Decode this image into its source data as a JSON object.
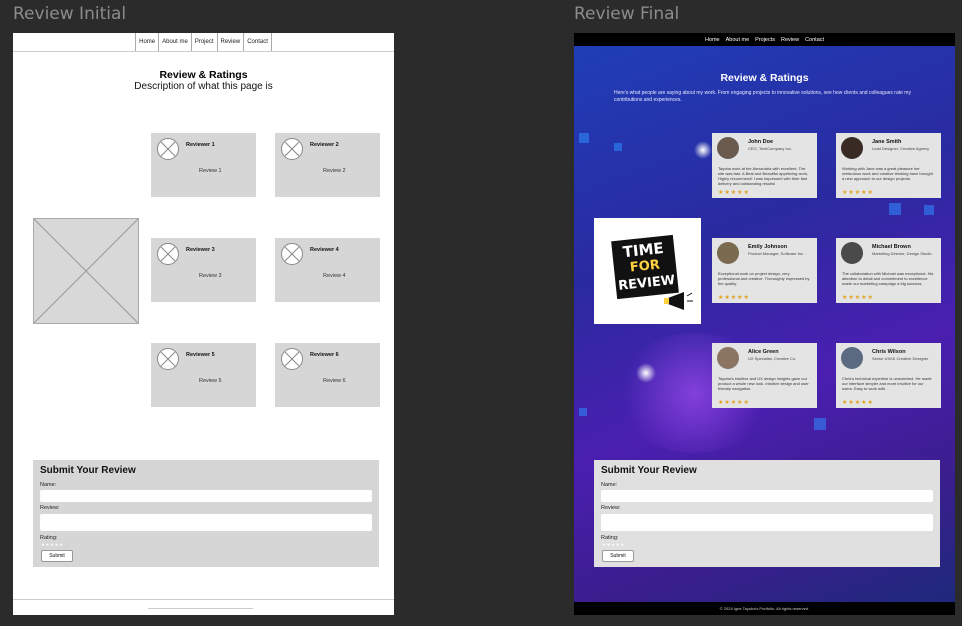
{
  "frame_labels": {
    "initial": "Review Initial",
    "final": "Review Final"
  },
  "nav": [
    "Home",
    "About me",
    "Projects",
    "Review",
    "Contact"
  ],
  "nav_initial": [
    "Home",
    "About me",
    "Project",
    "Review",
    "Contact"
  ],
  "initial": {
    "title": "Review & Ratings",
    "description": "Description of what this page is",
    "reviewers": [
      {
        "name": "Reviewer 1",
        "review": "Review 1"
      },
      {
        "name": "Reviewer 2",
        "review": "Review 2"
      },
      {
        "name": "Reviewer 3",
        "review": "Review 3"
      },
      {
        "name": "Reviewer 4",
        "review": "Review 4"
      },
      {
        "name": "Reviewer 5",
        "review": "Review 5"
      },
      {
        "name": "Reviewer 6",
        "review": "Review 6"
      }
    ],
    "form": {
      "title": "Submit Your Review",
      "name_label": "Name:",
      "review_label": "Review:",
      "rating_label": "Rating:",
      "rating_stars": "★★★★★",
      "submit_label": "Submit"
    }
  },
  "final": {
    "title": "Review & Ratings",
    "description": "Here's what people are saying about my work. From engaging projects to innovative solutions, see how clients and colleagues rate my contributions and experiences.",
    "promo": {
      "line1": "TIME",
      "line2": "FOR",
      "line3": "REVIEW"
    },
    "reviewers": [
      {
        "name": "John Doe",
        "role": "CEO, TechCompany Inc.",
        "text": "Tayoba work at the Alexandria with excellent. The site was fast. A Beal and Beautiful appetizing work, Highly recommend! I was impressed with their fast delivery and outstanding results!",
        "stars": "★★★★★"
      },
      {
        "name": "Jane Smith",
        "role": "Lead Designer, Creative Agency",
        "text": "Working with Jane was a great pleasure her meticulous work and creative thinking have brought a new approach to our design projects.",
        "stars": "★★★★★"
      },
      {
        "name": "Emily Johnson",
        "role": "Product Manager, Software Inc.",
        "text": "Exceptional work on project design, very professional and creative. Thoroughly impressed by the quality.",
        "stars": "★★★★★"
      },
      {
        "name": "Michael Brown",
        "role": "Marketing Director, Design Studio",
        "text": "The collaboration with Michael was exceptional. His attention to detail and commitment to excellence made our marketing campaign a big success.",
        "stars": "★★★★★"
      },
      {
        "name": "Alice Green",
        "role": "UX Specialist, Creative Co.",
        "text": "Tayoba's intuitive and UX design insights gave our product a whole new look. Intuitive design and user friendly navigation.",
        "stars": "★★★★★"
      },
      {
        "name": "Chris Wilson",
        "role": "Senior UX/UI Creative Designer",
        "text": "Chris's technical expertise is unmatched. He made our interface simpler and more intuitive for our users. Easy to work with.",
        "stars": "★★★★★"
      }
    ],
    "form": {
      "title": "Submit Your Review",
      "name_label": "Name:",
      "review_label": "Review:",
      "rating_label": "Rating:",
      "rating_stars": "★★★★★",
      "submit_label": "Submit"
    },
    "footer": "© 2024 Igne Tayoba's Portfolio. All rights reserved."
  },
  "colors": {
    "wire_gray": "#d6d6d6",
    "final_bg": "#1a1f6e",
    "star_gold": "#e0a21b"
  }
}
